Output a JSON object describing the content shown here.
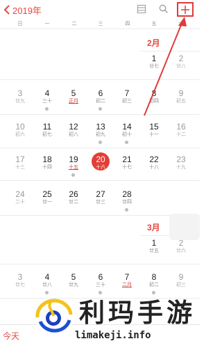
{
  "header": {
    "year_label": "2019年"
  },
  "weekdays": [
    "日",
    "一",
    "二",
    "三",
    "四",
    "五",
    "六"
  ],
  "months": [
    {
      "label": "2月",
      "weeks": [
        [
          null,
          null,
          null,
          null,
          null,
          {
            "d": "1",
            "sub": "廿七"
          },
          {
            "d": "2",
            "sub": "廿八"
          }
        ],
        [
          {
            "d": "3",
            "sub": "廿九"
          },
          {
            "d": "4",
            "sub": "三十",
            "dot": true
          },
          {
            "d": "5",
            "sub": "正月",
            "red": true
          },
          {
            "d": "6",
            "sub": "初二",
            "dot": true
          },
          {
            "d": "7",
            "sub": "初三"
          },
          {
            "d": "8",
            "sub": "初四"
          },
          {
            "d": "9",
            "sub": "初五"
          }
        ],
        [
          {
            "d": "10",
            "sub": "初六"
          },
          {
            "d": "11",
            "sub": "初七"
          },
          {
            "d": "12",
            "sub": "初八"
          },
          {
            "d": "13",
            "sub": "初九",
            "dot": true
          },
          {
            "d": "14",
            "sub": "初十",
            "dot": true
          },
          {
            "d": "15",
            "sub": "十一"
          },
          {
            "d": "16",
            "sub": "十二"
          }
        ],
        [
          {
            "d": "17",
            "sub": "十三"
          },
          {
            "d": "18",
            "sub": "十四"
          },
          {
            "d": "19",
            "sub": "十五",
            "red": true,
            "dot": true
          },
          {
            "d": "20",
            "sub": "十六",
            "today": true
          },
          {
            "d": "21",
            "sub": "十七"
          },
          {
            "d": "22",
            "sub": "十八"
          },
          {
            "d": "23",
            "sub": "十九"
          }
        ],
        [
          {
            "d": "24",
            "sub": "二十"
          },
          {
            "d": "25",
            "sub": "廿一"
          },
          {
            "d": "26",
            "sub": "廿二"
          },
          {
            "d": "27",
            "sub": "廿三"
          },
          {
            "d": "28",
            "sub": "廿四",
            "dot": true
          },
          null,
          null
        ]
      ]
    },
    {
      "label": "3月",
      "weeks": [
        [
          null,
          null,
          null,
          null,
          null,
          {
            "d": "1",
            "sub": "廿五"
          },
          {
            "d": "2",
            "sub": "廿六"
          }
        ],
        [
          {
            "d": "3",
            "sub": "廿七"
          },
          {
            "d": "4",
            "sub": "廿八",
            "dot": true
          },
          {
            "d": "5",
            "sub": "廿九"
          },
          {
            "d": "6",
            "sub": "三十",
            "dot": true
          },
          {
            "d": "7",
            "sub": "二月",
            "red": true
          },
          {
            "d": "8",
            "sub": "初二",
            "dot": true
          },
          {
            "d": "9",
            "sub": "初三"
          }
        ]
      ]
    }
  ],
  "footer": {
    "today_label": "今天"
  },
  "watermark": {
    "title": "利玛手游",
    "url": "limakeji.info"
  },
  "colors": {
    "accent": "#e8473e",
    "today_bg": "#e43d36",
    "arrow": "#e03a39"
  }
}
